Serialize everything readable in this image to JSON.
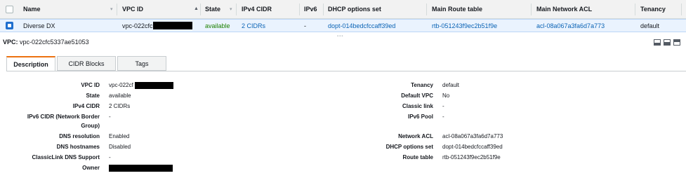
{
  "table": {
    "headers": [
      "Name",
      "VPC ID",
      "State",
      "IPv4 CIDR",
      "IPv6",
      "DHCP options set",
      "Main Route table",
      "Main Network ACL",
      "Tenancy"
    ],
    "row": {
      "name": "Diverse DX",
      "vpc_id": "vpc-022cfc",
      "state": "available",
      "ipv4_cidr": "2 CIDRs",
      "ipv6": "-",
      "dhcp": "dopt-014bedcfccaff39ed",
      "route_table": "rtb-051243f9ec2b51f9e",
      "network_acl": "acl-08a067a3fa6d7a773",
      "tenancy": "default"
    }
  },
  "details": {
    "title_label": "VPC:",
    "title_value": "vpc-022cfc5337ae51053",
    "tabs": [
      "Description",
      "CIDR Blocks",
      "Tags"
    ],
    "left": [
      {
        "label": "VPC ID",
        "value": "vpc-022cf"
      },
      {
        "label": "State",
        "value": "available"
      },
      {
        "label": "IPv4 CIDR",
        "value": "2 CIDRs"
      },
      {
        "label": "IPv6 CIDR (Network Border",
        "value": "-"
      },
      {
        "label": "Group)",
        "value": ""
      },
      {
        "label": "DNS resolution",
        "value": "Enabled"
      },
      {
        "label": "DNS hostnames",
        "value": "Disabled"
      },
      {
        "label": "ClassicLink DNS Support",
        "value": "-"
      },
      {
        "label": "Owner",
        "value": ""
      }
    ],
    "right": [
      {
        "label": "Tenancy",
        "value": "default"
      },
      {
        "label": "Default VPC",
        "value": "No"
      },
      {
        "label": "Classic link",
        "value": "-"
      },
      {
        "label": "IPv6 Pool",
        "value": "-"
      },
      {
        "label": "Network ACL",
        "value": "acl-08a067a3fa6d7a773"
      },
      {
        "label": "DHCP options set",
        "value": "dopt-014bedcfccaff39ed"
      },
      {
        "label": "Route table",
        "value": "rtb-051243f9ec2b51f9e"
      }
    ]
  },
  "colors": {
    "link": "#0a63b5",
    "available": "#1d8102",
    "active_tab": "#ec7211",
    "selected_row": "#eaf3fe"
  }
}
